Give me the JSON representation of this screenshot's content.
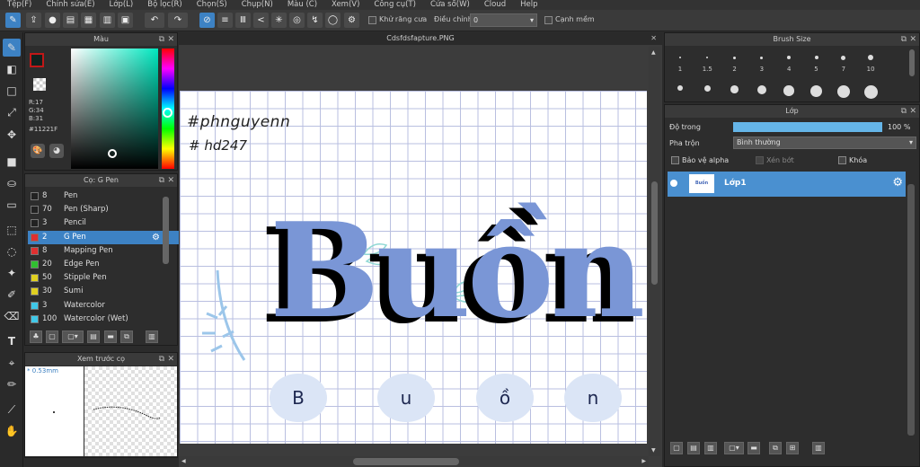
{
  "menu": [
    "Tệp(F)",
    "Chỉnh sửa(E)",
    "Lớp(L)",
    "Bộ lọc(R)",
    "Chọn(S)",
    "Chụp(N)",
    "Màu (C)",
    "Xem(V)",
    "Công cụ(T)",
    "Cửa sổ(W)",
    "Cloud",
    "Help"
  ],
  "toolbar": {
    "antialias_label": "Khử răng cưa",
    "adjust_label": "Điều chỉnh",
    "adjust_value": "0",
    "soft_edge_label": "Cạnh mềm"
  },
  "color_panel": {
    "title": "Màu",
    "r": "R:17",
    "g": "G:34",
    "b": "B:31",
    "hex": "#11221F",
    "fg_color": "#c01818",
    "bg_color": "#11221F"
  },
  "brush_panel": {
    "title": "Cọ: G Pen",
    "brushes": [
      {
        "size": "8",
        "name": "Pen",
        "color": "#222222"
      },
      {
        "size": "70",
        "name": "Pen (Sharp)",
        "color": "#222222"
      },
      {
        "size": "3",
        "name": "Pencil",
        "color": "#222222"
      },
      {
        "size": "2",
        "name": "G Pen",
        "color": "#e03030",
        "selected": true
      },
      {
        "size": "8",
        "name": "Mapping Pen",
        "color": "#e03030"
      },
      {
        "size": "20",
        "name": "Edge Pen",
        "color": "#30c030"
      },
      {
        "size": "50",
        "name": "Stipple Pen",
        "color": "#e0d020"
      },
      {
        "size": "30",
        "name": "Sumi",
        "color": "#e0d020"
      },
      {
        "size": "3",
        "name": "Watercolor",
        "color": "#40c8e8"
      },
      {
        "size": "100",
        "name": "Watercolor (Wet)",
        "color": "#40c8e8"
      }
    ]
  },
  "preview_panel": {
    "title": "Xem trước cọ",
    "size": "0.53mm"
  },
  "canvas": {
    "tab_title": "Cdsfdsfapture.PNG",
    "hashtag1": "#phnguyenn",
    "hashtag2": "# hd247",
    "big_word": "Buồn",
    "letters": [
      "B",
      "u",
      "ồ",
      "n"
    ]
  },
  "brush_size_panel": {
    "title": "Brush Size",
    "sizes": [
      "1",
      "1.5",
      "2",
      "3",
      "4",
      "5",
      "7",
      "10"
    ]
  },
  "layer_panel": {
    "title": "Lớp",
    "opacity_label": "Độ trong",
    "opacity_value": "100 %",
    "opacity_fraction": 1.0,
    "blend_label": "Pha trộn",
    "blend_value": "Bình thường",
    "protect_alpha": "Bảo vệ alpha",
    "clipping": "Xén bớt",
    "lock": "Khóa",
    "layer_name": "Lớp1",
    "thumb_text": "Buồn"
  }
}
